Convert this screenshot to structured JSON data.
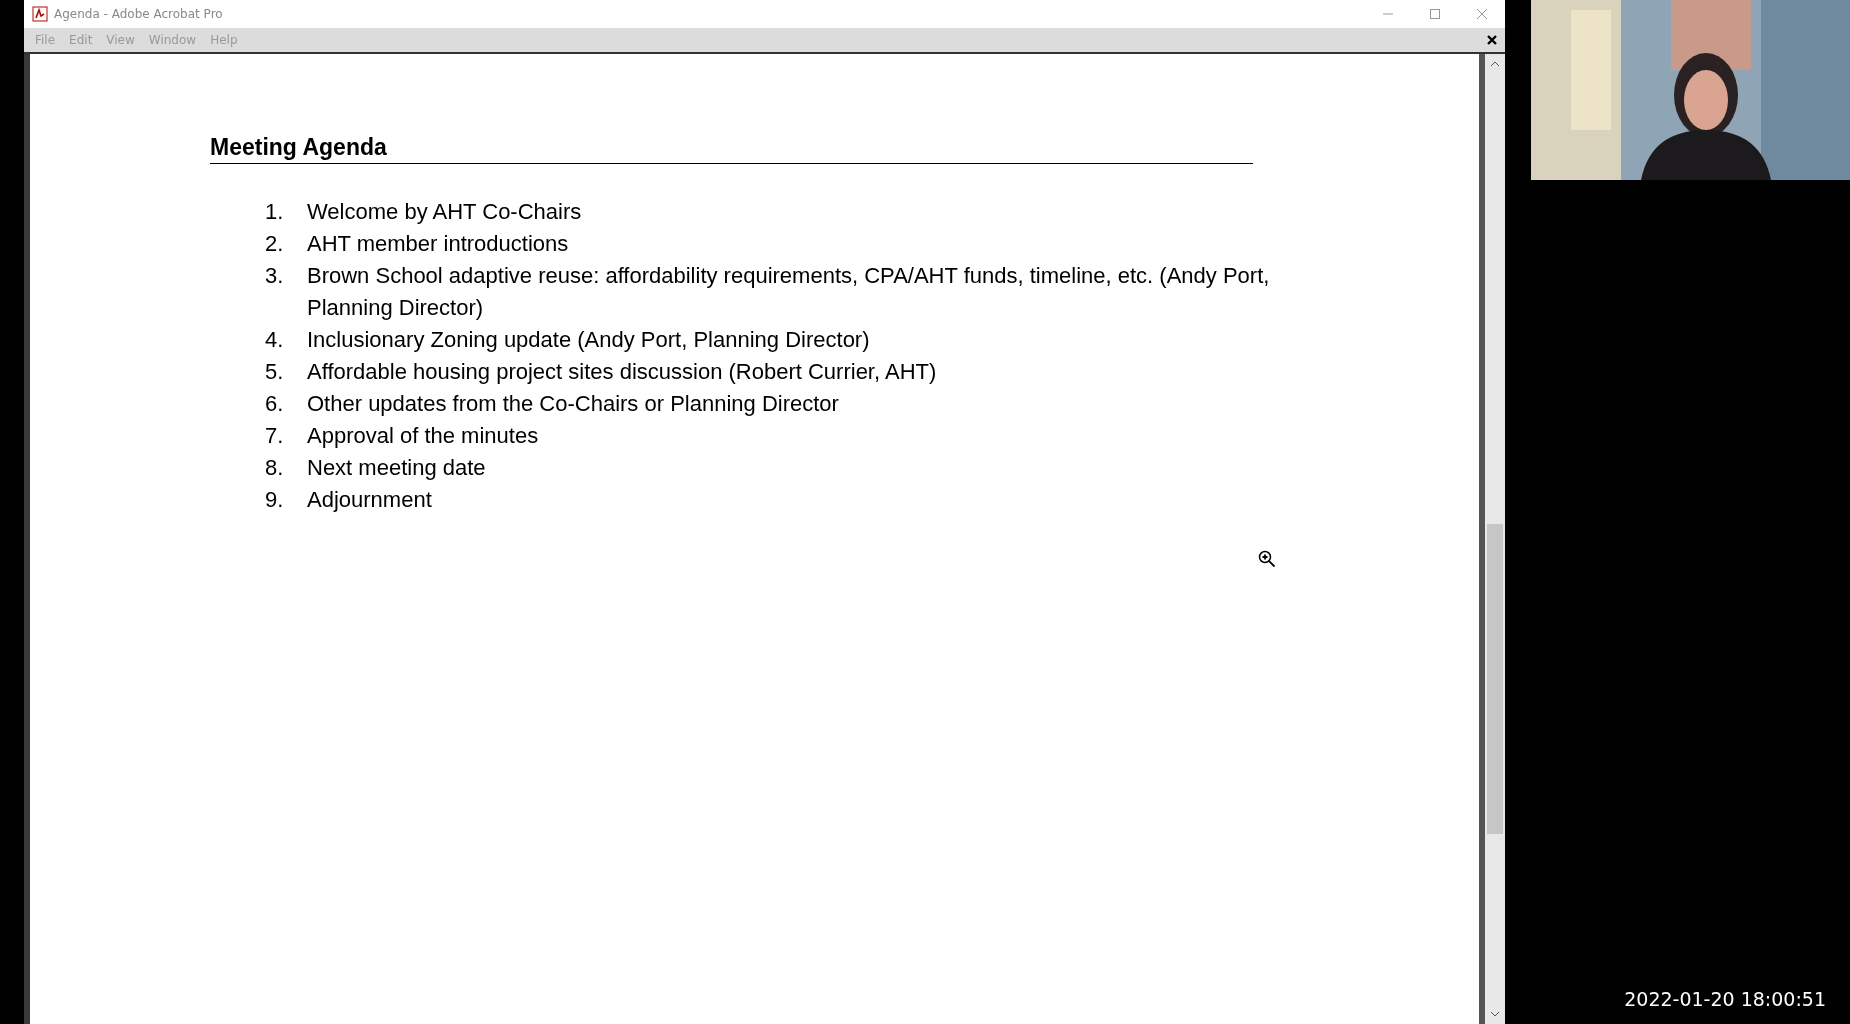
{
  "window": {
    "title": "Agenda - Adobe Acrobat Pro"
  },
  "menu": [
    "File",
    "Edit",
    "View",
    "Window",
    "Help"
  ],
  "document": {
    "heading": "Meeting Agenda",
    "items": [
      {
        "number": "1.",
        "text": "Welcome by AHT Co-Chairs"
      },
      {
        "number": "2.",
        "text": "AHT member introductions"
      },
      {
        "number": "3.",
        "text": "Brown School adaptive reuse: affordability requirements, CPA/AHT funds, timeline, etc. (Andy Port, Planning Director)"
      },
      {
        "number": "4.",
        "text": "Inclusionary Zoning update (Andy Port, Planning Director)"
      },
      {
        "number": "5.",
        "text": "Affordable housing project sites discussion (Robert Currier, AHT)"
      },
      {
        "number": "6.",
        "text": "Other updates from the Co-Chairs or Planning Director"
      },
      {
        "number": "7.",
        "text": "Approval of the minutes"
      },
      {
        "number": "8.",
        "text": "Next meeting date"
      },
      {
        "number": "9.",
        "text": "Adjournment"
      }
    ]
  },
  "timestamp": "2022-01-20 18:00:51"
}
